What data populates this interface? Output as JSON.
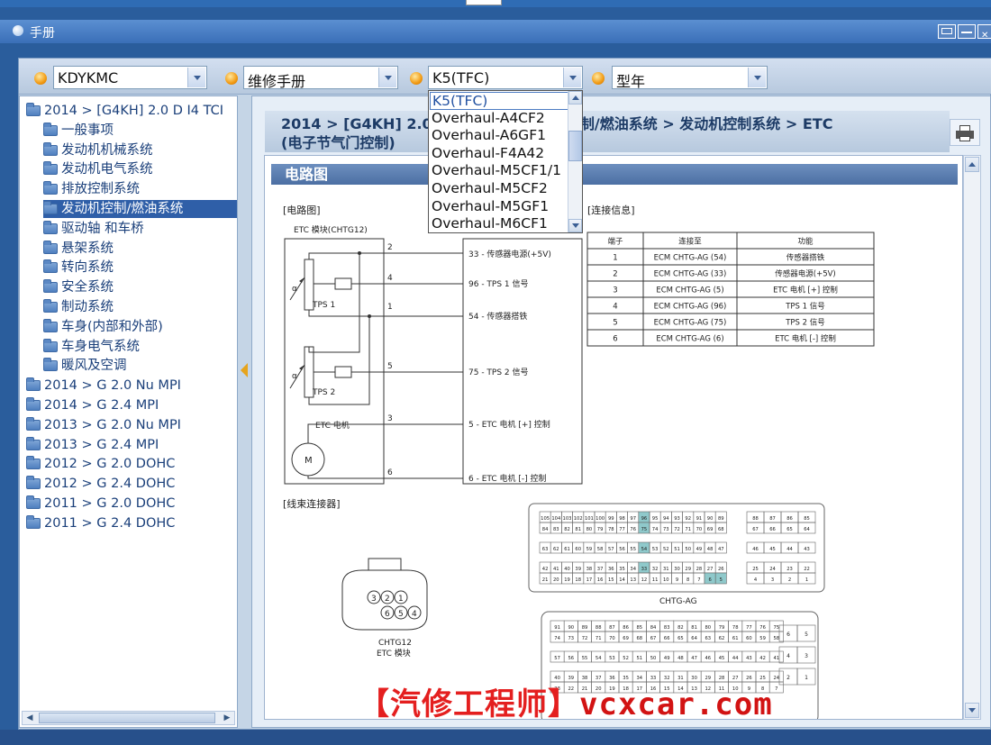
{
  "window": {
    "title": "手册"
  },
  "toolbar": {
    "combos": [
      {
        "value": "KDYKMC"
      },
      {
        "value": "维修手册"
      },
      {
        "value": "K5(TFC)"
      },
      {
        "value": "型年"
      }
    ]
  },
  "dropdown": {
    "options": [
      "K5(TFC)",
      "Overhaul-A4CF2",
      "Overhaul-A6GF1",
      "Overhaul-F4A42",
      "Overhaul-M5CF1/1",
      "Overhaul-M5CF2",
      "Overhaul-M5GF1",
      "Overhaul-M6CF1"
    ],
    "selected": "K5(TFC)"
  },
  "tree": {
    "items": [
      {
        "label": "2014 > [G4KH] 2.0 D I4 TCI",
        "level": 0
      },
      {
        "label": "一般事项",
        "level": 1
      },
      {
        "label": "发动机机械系统",
        "level": 1
      },
      {
        "label": "发动机电气系统",
        "level": 1
      },
      {
        "label": "排放控制系统",
        "level": 1
      },
      {
        "label": "发动机控制/燃油系统",
        "level": 1,
        "selected": true
      },
      {
        "label": "驱动轴 和车桥",
        "level": 1
      },
      {
        "label": "悬架系统",
        "level": 1
      },
      {
        "label": "转向系统",
        "level": 1
      },
      {
        "label": "安全系统",
        "level": 1
      },
      {
        "label": "制动系统",
        "level": 1
      },
      {
        "label": "车身(内部和外部)",
        "level": 1
      },
      {
        "label": "车身电气系统",
        "level": 1
      },
      {
        "label": "暖风及空调",
        "level": 1
      },
      {
        "label": "2014 > G 2.0 Nu MPI",
        "level": 0
      },
      {
        "label": "2014 > G 2.4 MPI",
        "level": 0
      },
      {
        "label": "2013 > G 2.0 Nu MPI",
        "level": 0
      },
      {
        "label": "2013 > G 2.4 MPI",
        "level": 0
      },
      {
        "label": "2012 > G 2.0 DOHC",
        "level": 0
      },
      {
        "label": "2012 > G 2.4 DOHC",
        "level": 0
      },
      {
        "label": "2011 > G 2.0 DOHC",
        "level": 0
      },
      {
        "label": "2011 > G 2.4 DOHC",
        "level": 0
      }
    ]
  },
  "content": {
    "breadcrumb_line1": "2014 > [G4KH] 2.0 D I4 TCI > 发动机控制/燃油系统 > 发动机控制系统 > ETC",
    "breadcrumb_line2": "(电子节气门控制)",
    "section_title": "电路图"
  },
  "diagram": {
    "circuit_label": "[电路图]",
    "connection_label": "[连接信息]",
    "harness_label": "[线束连接器]",
    "module_name": "ETC 模块(CHTG12)",
    "tps1": "TPS 1",
    "tps2": "TPS 2",
    "motor_label": "ETC 电机",
    "motor_symbol": "M",
    "alpha": "α",
    "pins": [
      "2",
      "4",
      "1",
      "5",
      "3",
      "6"
    ],
    "ecm_pins": [
      "33 - 传感器电源(+5V)",
      "96 - TPS 1 信号",
      "54 - 传感器搭铁",
      "75 - TPS 2 信号",
      "5 - ETC 电机 [+] 控制",
      "6 - ETC 电机 [-] 控制"
    ],
    "table": {
      "headers": [
        "端子",
        "连接至",
        "功能"
      ],
      "rows": [
        [
          "1",
          "ECM CHTG-AG (54)",
          "传感器搭铁"
        ],
        [
          "2",
          "ECM CHTG-AG (33)",
          "传感器电源(+5V)"
        ],
        [
          "3",
          "ECM CHTG-AG (5)",
          "ETC 电机 [+] 控制"
        ],
        [
          "4",
          "ECM CHTG-AG (96)",
          "TPS 1 信号"
        ],
        [
          "5",
          "ECM CHTG-AG (75)",
          "TPS 2 信号"
        ],
        [
          "6",
          "ECM CHTG-AG (6)",
          "ETC 电机 [-] 控制"
        ]
      ]
    },
    "connector_label": "CHTG-AG",
    "chtg12_label": "CHTG12",
    "chtg12_sub": "ETC 模块",
    "chtg12_pins_top": [
      "3",
      "2",
      "1"
    ],
    "chtg12_pins_bottom": [
      "6",
      "5",
      "4"
    ],
    "conn_a_rows": [
      [
        "105",
        "104",
        "103",
        "102",
        "101",
        "100",
        "99",
        "98",
        "97",
        "96",
        "95",
        "94",
        "93",
        "92",
        "91",
        "90",
        "89"
      ],
      [
        "84",
        "83",
        "82",
        "81",
        "80",
        "79",
        "78",
        "77",
        "76",
        "75",
        "74",
        "73",
        "72",
        "71",
        "70",
        "69",
        "68"
      ],
      [
        "63",
        "62",
        "61",
        "60",
        "59",
        "58",
        "57",
        "56",
        "55",
        "54",
        "53",
        "52",
        "51",
        "50",
        "49",
        "48",
        "47"
      ],
      [
        "42",
        "41",
        "40",
        "39",
        "38",
        "37",
        "36",
        "35",
        "34",
        "33",
        "32",
        "31",
        "30",
        "29",
        "28",
        "27",
        "26"
      ],
      [
        "21",
        "20",
        "19",
        "18",
        "17",
        "16",
        "15",
        "14",
        "13",
        "12",
        "11",
        "10",
        "9",
        "8",
        "7",
        "6",
        "5"
      ]
    ],
    "conn_a_right": [
      [
        "88",
        "87",
        "86",
        "85"
      ],
      [
        "67",
        "66",
        "65",
        "64"
      ],
      [
        "46",
        "45",
        "44",
        "43"
      ],
      [
        "25",
        "24",
        "23",
        "22"
      ],
      [
        "4",
        "3",
        "2",
        "1"
      ]
    ],
    "highlight_pins": [
      "96",
      "75",
      "54",
      "33",
      "6",
      "5"
    ],
    "conn_b_rows": [
      [
        "91",
        "90",
        "89",
        "88",
        "87",
        "86",
        "85",
        "84",
        "83",
        "82",
        "81",
        "80",
        "79",
        "78",
        "77",
        "76",
        "75"
      ],
      [
        "74",
        "73",
        "72",
        "71",
        "70",
        "69",
        "68",
        "67",
        "66",
        "65",
        "64",
        "63",
        "62",
        "61",
        "60",
        "59",
        "58"
      ],
      [
        "57",
        "56",
        "55",
        "54",
        "53",
        "52",
        "51",
        "50",
        "49",
        "48",
        "47",
        "46",
        "45",
        "44",
        "43",
        "42",
        "41"
      ],
      [
        "40",
        "39",
        "38",
        "37",
        "36",
        "35",
        "34",
        "33",
        "32",
        "31",
        "30",
        "29",
        "28",
        "27",
        "26",
        "25",
        "24"
      ],
      [
        "23",
        "22",
        "21",
        "20",
        "19",
        "18",
        "17",
        "16",
        "15",
        "14",
        "13",
        "12",
        "11",
        "10",
        "9",
        "8",
        "7"
      ]
    ],
    "conn_b_right": [
      [
        "6",
        "5"
      ],
      [
        "4",
        "3"
      ],
      [
        "2",
        "1"
      ]
    ]
  },
  "watermark": {
    "text": "【汽修工程师】",
    "site": "vcxcar.com"
  },
  "colors": {
    "highlight": "#8fc9cb",
    "selection": "#2f5fa8",
    "watermark": "#e41f1f"
  }
}
